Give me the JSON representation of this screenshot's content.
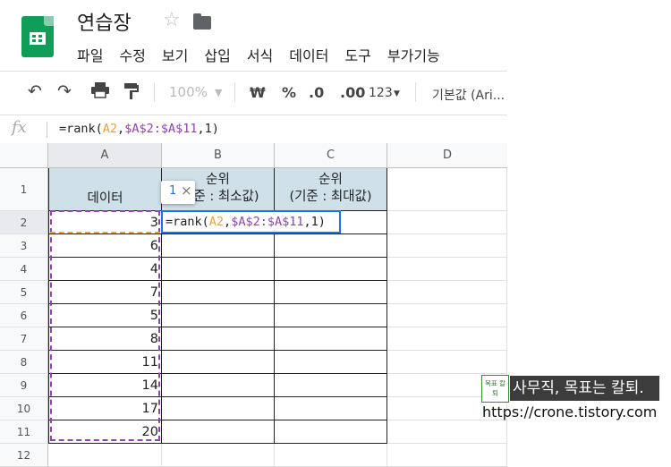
{
  "header": {
    "title": "연습장",
    "menu": [
      "파일",
      "수정",
      "보기",
      "삽입",
      "서식",
      "데이터",
      "도구",
      "부가기능"
    ]
  },
  "toolbar": {
    "zoom": "100%",
    "currency": "₩",
    "percent": "%",
    "dec_decrease": ".0",
    "dec_increase": ".00",
    "more_formats": "123",
    "font": "기본값 (Ari..."
  },
  "formula_bar": {
    "fx": "fx",
    "formula": {
      "prefix": "=rank(",
      "arg1": "A2",
      "comma1": ",",
      "arg2": "$A$2:$A$11",
      "comma2": ",",
      "arg3": "1",
      "suffix": ")"
    }
  },
  "sheet": {
    "columns": [
      "A",
      "B",
      "C",
      "D"
    ],
    "rows": [
      "1",
      "2",
      "3",
      "4",
      "5",
      "6",
      "7",
      "8",
      "9",
      "10",
      "11",
      "12"
    ],
    "headers": {
      "a": "데이터",
      "b_line1": "순위",
      "b_line2": "(기준 : 최소값)",
      "c_line1": "순위",
      "c_line2": "(기준 : 최대값)"
    },
    "data_values": [
      "3",
      "6",
      "4",
      "7",
      "5",
      "8",
      "11",
      "14",
      "17",
      "20"
    ]
  },
  "tooltip": {
    "number": "1",
    "close": "×"
  },
  "watermark": {
    "logo_text": "목표 칼퇴",
    "caption": "사무직, 목표는 칼퇴.",
    "url": "https://crone.tistory.com"
  },
  "colors": {
    "brand_green": "#0f9d58",
    "header_fill": "#cfe0e8",
    "editor_border": "#1a73e8",
    "range_ref": "#8e44ad",
    "cell_ref": "#e8a33a"
  }
}
